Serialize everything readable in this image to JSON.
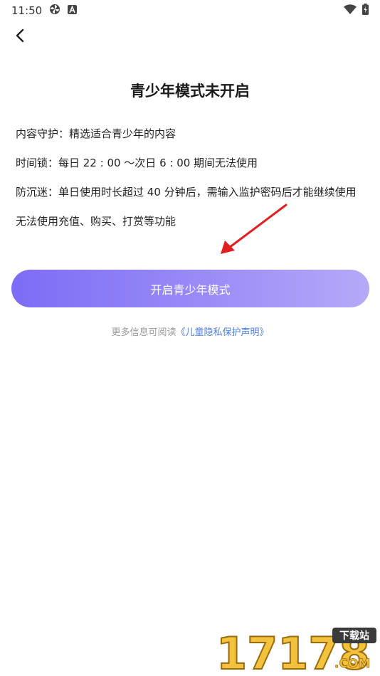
{
  "status_bar": {
    "time": "11:50",
    "icons": [
      "pinwheel-icon",
      "a-badge-icon",
      "wifi-icon",
      "battery-icon"
    ]
  },
  "header": {
    "back_icon": "chevron-left-icon"
  },
  "main": {
    "title": "青少年模式未开启",
    "features": [
      "内容守护：精选适合青少年的内容",
      "时间锁：每日 22 : 00 ～次日 6 : 00 期间无法使用",
      "防沉迷：单日使用时长超过 40 分钟后，需输入监护密码后才能继续使用",
      "无法使用充值、购买、打赏等功能"
    ],
    "enable_button_label": "开启青少年模式",
    "info_prefix": "更多信息可阅读",
    "privacy_link": "《儿童隐私保护声明》"
  },
  "watermark": {
    "digits": "17178",
    "badge": "下载站",
    "domain": ".COM"
  },
  "colors": {
    "button_start": "#7c6cf6",
    "button_end": "#b5a9f8",
    "link": "#4f7fe0",
    "annotation_arrow": "#e02020"
  }
}
